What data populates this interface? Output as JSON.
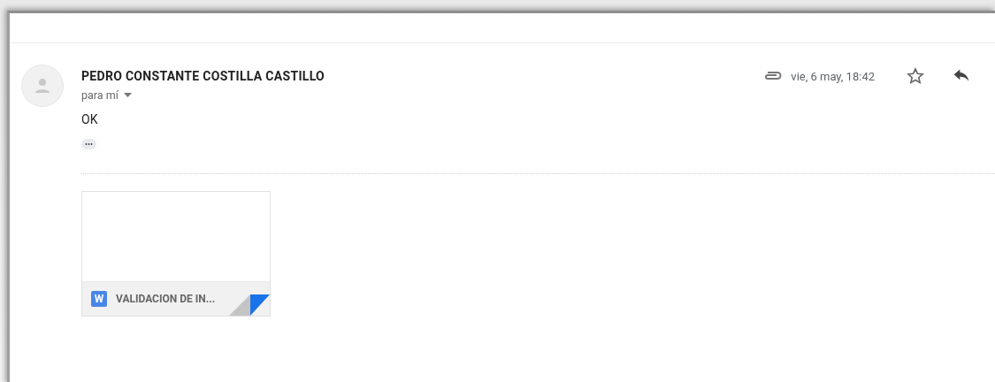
{
  "message": {
    "sender": "PEDRO CONSTANTE COSTILLA CASTILLO",
    "recipient": "para mí",
    "date": "vie, 6 may, 18:42",
    "has_attachment": true,
    "starred": false,
    "body": "OK",
    "trimmed_content": "•••"
  },
  "attachments": [
    {
      "type_letter": "W",
      "name": "VALIDACION DE IN..."
    }
  ]
}
